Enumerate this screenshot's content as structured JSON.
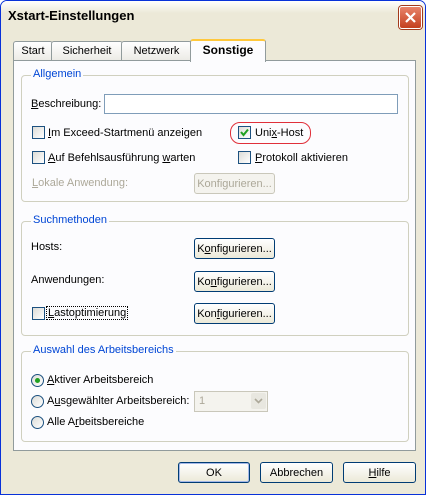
{
  "window": {
    "title": "Xstart-Einstellungen"
  },
  "tabs": [
    {
      "label": "Start"
    },
    {
      "label": "Sicherheit"
    },
    {
      "label": "Netzwerk"
    },
    {
      "label": "Sonstige"
    }
  ],
  "allgemein": {
    "title": "Allgemein",
    "beschreibung_label": "Beschreibung:",
    "beschreibung_value": "",
    "cb_startmenu": "Im Exceed-Startmenü anzeigen",
    "cb_unixhost": "Unix-Host",
    "cb_unixhost_checked": true,
    "cb_warten": "Auf Befehlsausführung warten",
    "cb_protokoll": "Protokoll aktivieren",
    "lokale_label": "Lokale Anwendung:",
    "lokale_button": "Konfigurieren..."
  },
  "suchmethoden": {
    "title": "Suchmethoden",
    "hosts_label": "Hosts:",
    "hosts_button": "Konfigurieren...",
    "anwendungen_label": "Anwendungen:",
    "anwendungen_button": "Konfigurieren...",
    "last_label": "Lastoptimierung",
    "last_button": "Konfigurieren..."
  },
  "arbeitsbereich": {
    "title": "Auswahl des Arbeitsbereichs",
    "radio_aktiv": "Aktiver Arbeitsbereich",
    "radio_ausgewaehlt": "Ausgewählter Arbeitsbereich:",
    "radio_alle": "Alle Arbeitsbereiche",
    "selected": "aktiv",
    "combo_value": "1"
  },
  "footer": {
    "ok": "OK",
    "abbrechen": "Abbrechen",
    "hilfe": "Hilfe"
  }
}
